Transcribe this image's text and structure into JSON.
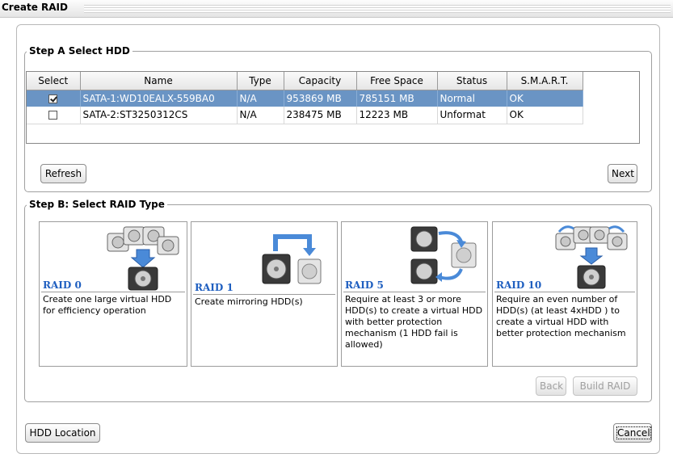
{
  "window": {
    "title": "Create RAID"
  },
  "stepA": {
    "legend": "Step A Select HDD",
    "columns": [
      "Select",
      "Name",
      "Type",
      "Capacity",
      "Free Space",
      "Status",
      "S.M.A.R.T."
    ],
    "rows": [
      {
        "selected": true,
        "name": "SATA-1:WD10EALX-559BA0",
        "type": "N/A",
        "capacity": "953869 MB",
        "free": "785151 MB",
        "status": "Normal",
        "smart": "OK"
      },
      {
        "selected": false,
        "name": "SATA-2:ST3250312CS",
        "type": "N/A",
        "capacity": "238475 MB",
        "free": "12223 MB",
        "status": "Unformat",
        "smart": "OK"
      }
    ],
    "refresh_label": "Refresh",
    "next_label": "Next"
  },
  "stepB": {
    "legend": "Step B: Select RAID Type",
    "types": [
      {
        "title": "RAID 0",
        "desc": "Create one large virtual HDD for efficiency operation",
        "icon": "raid0-disks-icon"
      },
      {
        "title": "RAID 1",
        "desc": "Create mirroring HDD(s)",
        "icon": "raid1-mirror-icon"
      },
      {
        "title": "RAID 5",
        "desc": "Require at least 3 or more HDD(s)  to create a virtual HDD with better protection mechanism (1 HDD fail is allowed)",
        "icon": "raid5-disks-icon"
      },
      {
        "title": "RAID 10",
        "desc": "Require an even number of HDD(s) (at least 4xHDD ) to create a virtual HDD with better protection mechanism",
        "icon": "raid10-disks-icon"
      }
    ],
    "back_label": "Back",
    "build_label": "Build RAID"
  },
  "footer": {
    "hdd_location_label": "HDD Location",
    "cancel_label": "Cancel"
  },
  "colors": {
    "selection": "#6a94c4",
    "raid_title": "#1f5fc0",
    "arrow": "#4a8ad8"
  }
}
